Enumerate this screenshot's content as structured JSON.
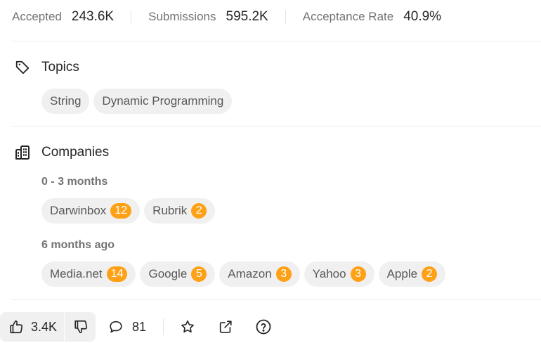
{
  "stats": {
    "accepted_label": "Accepted",
    "accepted_value": "243.6K",
    "submissions_label": "Submissions",
    "submissions_value": "595.2K",
    "acceptance_label": "Acceptance Rate",
    "acceptance_value": "40.9%"
  },
  "topics": {
    "title": "Topics",
    "icon": "tag-icon",
    "tags": [
      "String",
      "Dynamic Programming"
    ]
  },
  "companies": {
    "title": "Companies",
    "icon": "building-icon",
    "groups": [
      {
        "label": "0 - 3 months",
        "items": [
          {
            "name": "Darwinbox",
            "count": "12"
          },
          {
            "name": "Rubrik",
            "count": "2"
          }
        ]
      },
      {
        "label": "6 months ago",
        "items": [
          {
            "name": "Media.net",
            "count": "14"
          },
          {
            "name": "Google",
            "count": "5"
          },
          {
            "name": "Amazon",
            "count": "3"
          },
          {
            "name": "Yahoo",
            "count": "3"
          },
          {
            "name": "Apple",
            "count": "2"
          }
        ]
      }
    ],
    "badge_color": "#ffa116"
  },
  "footer": {
    "likes": "3.4K",
    "comments": "81",
    "icons": [
      "thumbs-up-icon",
      "thumbs-down-icon",
      "comment-icon",
      "star-icon",
      "share-icon",
      "help-icon"
    ]
  }
}
